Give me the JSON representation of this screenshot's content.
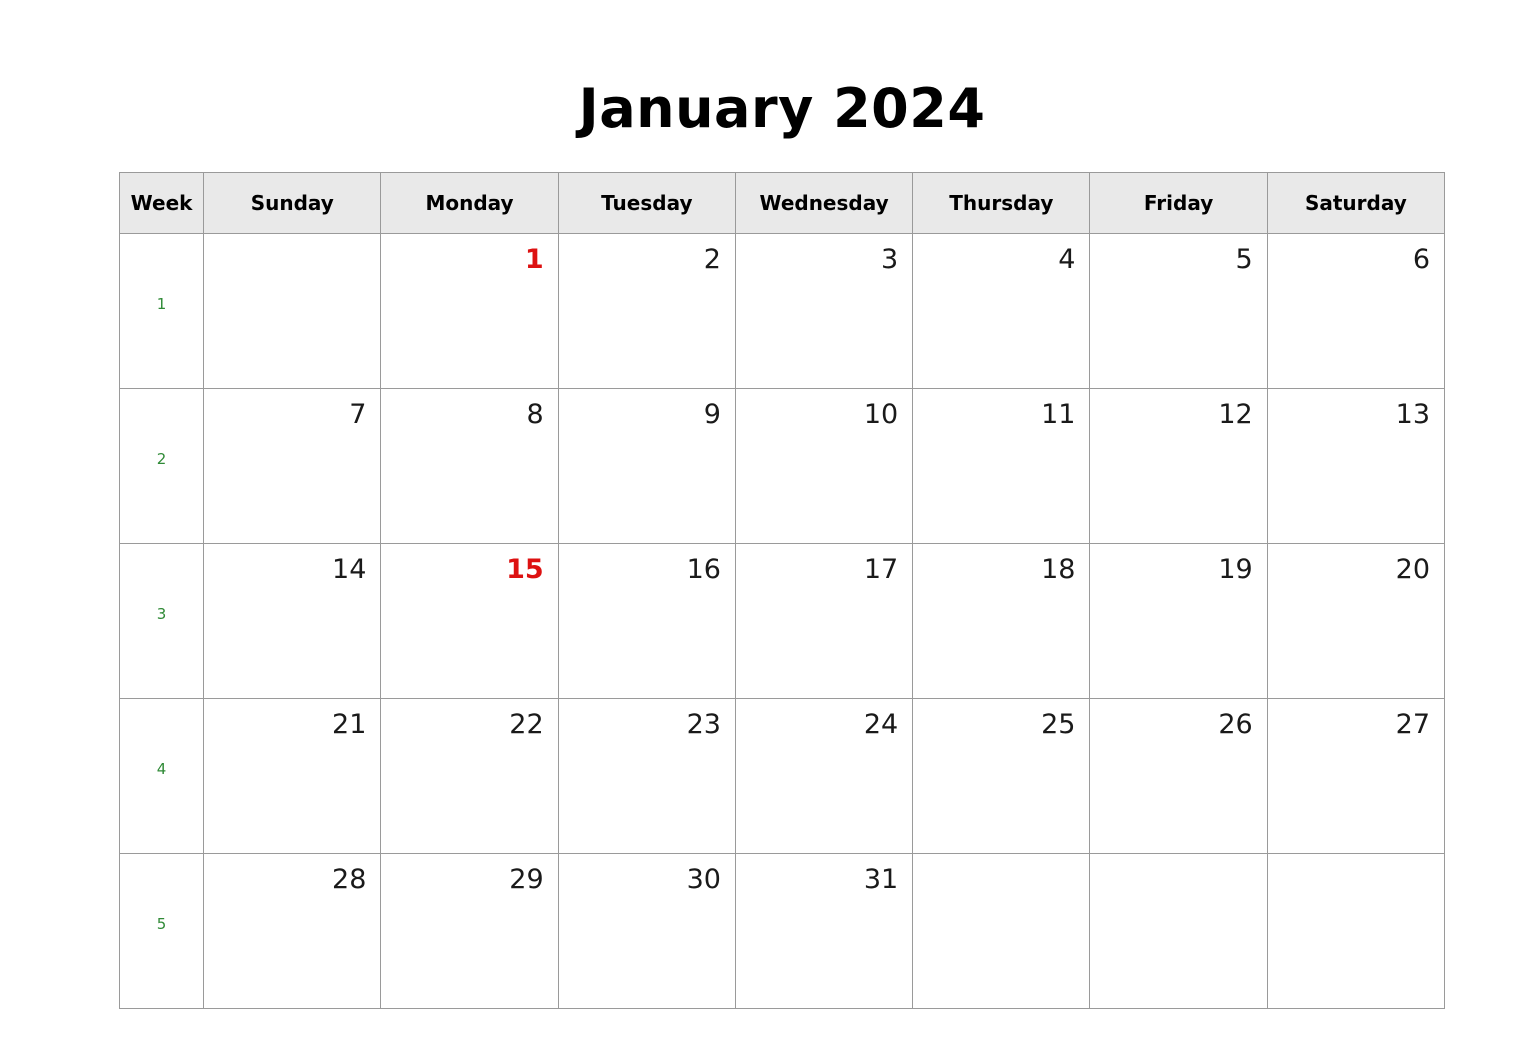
{
  "calendar": {
    "title": "January 2024",
    "columns": [
      "Week",
      "Sunday",
      "Monday",
      "Tuesday",
      "Wednesday",
      "Thursday",
      "Friday",
      "Saturday"
    ],
    "colors": {
      "holiday": "#dd1111",
      "week_number": "#2f8a36",
      "day_number": "#1a1a1a",
      "header_background": "#e9e9e9",
      "border": "#9a9a9a",
      "page_background": "#ffffff"
    },
    "weeks": [
      {
        "week_number": "1",
        "days": [
          {
            "label": "",
            "holiday": false
          },
          {
            "label": "1",
            "holiday": true
          },
          {
            "label": "2",
            "holiday": false
          },
          {
            "label": "3",
            "holiday": false
          },
          {
            "label": "4",
            "holiday": false
          },
          {
            "label": "5",
            "holiday": false
          },
          {
            "label": "6",
            "holiday": false
          }
        ]
      },
      {
        "week_number": "2",
        "days": [
          {
            "label": "7",
            "holiday": false
          },
          {
            "label": "8",
            "holiday": false
          },
          {
            "label": "9",
            "holiday": false
          },
          {
            "label": "10",
            "holiday": false
          },
          {
            "label": "11",
            "holiday": false
          },
          {
            "label": "12",
            "holiday": false
          },
          {
            "label": "13",
            "holiday": false
          }
        ]
      },
      {
        "week_number": "3",
        "days": [
          {
            "label": "14",
            "holiday": false
          },
          {
            "label": "15",
            "holiday": true
          },
          {
            "label": "16",
            "holiday": false
          },
          {
            "label": "17",
            "holiday": false
          },
          {
            "label": "18",
            "holiday": false
          },
          {
            "label": "19",
            "holiday": false
          },
          {
            "label": "20",
            "holiday": false
          }
        ]
      },
      {
        "week_number": "4",
        "days": [
          {
            "label": "21",
            "holiday": false
          },
          {
            "label": "22",
            "holiday": false
          },
          {
            "label": "23",
            "holiday": false
          },
          {
            "label": "24",
            "holiday": false
          },
          {
            "label": "25",
            "holiday": false
          },
          {
            "label": "26",
            "holiday": false
          },
          {
            "label": "27",
            "holiday": false
          }
        ]
      },
      {
        "week_number": "5",
        "days": [
          {
            "label": "28",
            "holiday": false
          },
          {
            "label": "29",
            "holiday": false
          },
          {
            "label": "30",
            "holiday": false
          },
          {
            "label": "31",
            "holiday": false
          },
          {
            "label": "",
            "holiday": false
          },
          {
            "label": "",
            "holiday": false
          },
          {
            "label": "",
            "holiday": false
          }
        ]
      }
    ]
  }
}
